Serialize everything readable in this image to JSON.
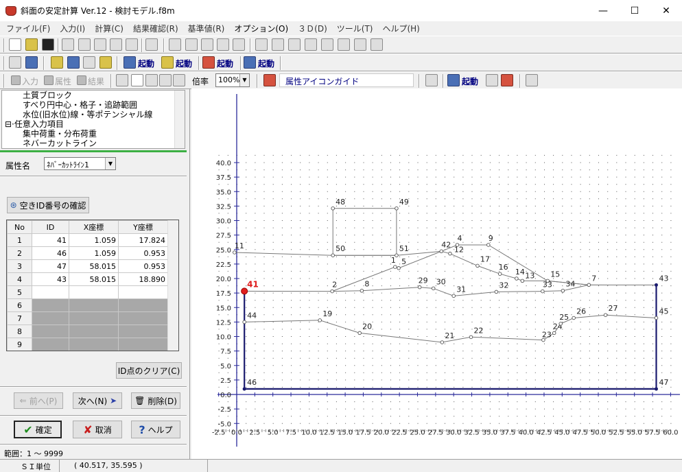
{
  "window": {
    "title": "斜面の安定計算 Ver.12 - 検討モデル.f8m",
    "min": "—",
    "max": "☐",
    "close": "✕"
  },
  "menu": [
    "ファイル(F)",
    "入力(I)",
    "計算(C)",
    "結果確認(R)",
    "基準値(R)",
    "オプション(O)",
    "３Ｄ(D)",
    "ツール(T)",
    "ヘルプ(H)"
  ],
  "toolbar2": {
    "kidou1": "起動",
    "kidou2": "起動",
    "kidou3": "起動",
    "kidou4": "起動"
  },
  "toolbar3": {
    "input": "入力",
    "attr": "属性",
    "result": "結果",
    "zoom_label": "倍率",
    "zoom_value": "100%",
    "guide": "属性アイコンガイド",
    "kidou": "起動"
  },
  "tree": [
    "土質ブロック",
    "すべり円中心・格子・追跡範囲",
    "水位(旧水位)線・等ポテンシャル線",
    "任意入力項目",
    "集中荷重・分布荷重",
    "ネバーカットライン"
  ],
  "attr": {
    "label": "属性名",
    "value": "ﾈﾊﾞｰｶｯﾄﾗｲﾝ1"
  },
  "buttons": {
    "check_id": "空きID番号の確認",
    "clear_id": "ID点のクリア(C)",
    "prev": "前へ(P)",
    "next": "次へ(N)",
    "delete": "削除(D)",
    "ok": "確定",
    "cancel": "取消",
    "help": "ヘルプ"
  },
  "table": {
    "headers": [
      "No",
      "ID",
      "X座標",
      "Y座標"
    ],
    "rows": [
      [
        "1",
        "41",
        "1.059",
        "17.824"
      ],
      [
        "2",
        "46",
        "1.059",
        "0.953"
      ],
      [
        "3",
        "47",
        "58.015",
        "0.953"
      ],
      [
        "4",
        "43",
        "58.015",
        "18.890"
      ],
      [
        "5",
        "",
        "",
        ""
      ],
      [
        "6",
        "",
        "",
        ""
      ],
      [
        "7",
        "",
        "",
        ""
      ],
      [
        "8",
        "",
        "",
        ""
      ],
      [
        "9",
        "",
        "",
        ""
      ]
    ]
  },
  "range": "範囲：1 〜 9999",
  "status": {
    "units": "ＳＩ単位",
    "coords": "(  40.517,  35.595 )"
  },
  "plot": {
    "x_ticks": [
      "-2.5",
      "0.0",
      "2.5",
      "5.0",
      "7.5",
      "10.0",
      "12.5",
      "15.0",
      "17.5",
      "20.0",
      "22.5",
      "25.0",
      "27.5",
      "30.0",
      "32.5",
      "35.0",
      "37.5",
      "40.0",
      "42.5",
      "45.0",
      "47.5",
      "50.0",
      "52.5",
      "55.0",
      "57.5",
      "60.0"
    ],
    "y_ticks": [
      "40.0",
      "37.5",
      "35.0",
      "32.5",
      "30.0",
      "27.5",
      "25.0",
      "22.5",
      "20.0",
      "17.5",
      "15.0",
      "12.5",
      "10.0",
      "7.5",
      "5.0",
      "2.5",
      "0.0",
      "-2.5",
      "-5.0"
    ],
    "point_labels": [
      "1",
      "2",
      "4",
      "5",
      "7",
      "8",
      "9",
      "11",
      "12",
      "13",
      "14",
      "15",
      "16",
      "17",
      "19",
      "20",
      "21",
      "22",
      "23",
      "24",
      "25",
      "26",
      "27",
      "29",
      "30",
      "31",
      "32",
      "33",
      "34",
      "41",
      "42",
      "43",
      "44",
      "45",
      "46",
      "47",
      "48",
      "49",
      "50",
      "51"
    ]
  }
}
